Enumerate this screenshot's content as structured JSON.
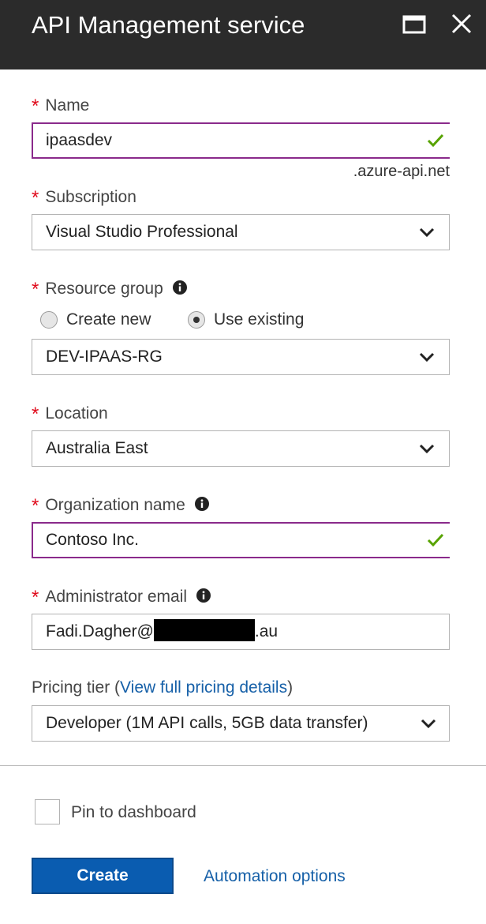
{
  "header": {
    "title": "API Management service"
  },
  "name": {
    "label": "Name",
    "value": "ipaasdev",
    "suffix": ".azure-api.net"
  },
  "subscription": {
    "label": "Subscription",
    "value": "Visual Studio Professional"
  },
  "resource_group": {
    "label": "Resource group",
    "option_new": "Create new",
    "option_existing": "Use existing",
    "selected": "Use existing",
    "value": "DEV-IPAAS-RG"
  },
  "location": {
    "label": "Location",
    "value": "Australia East"
  },
  "organization": {
    "label": "Organization name",
    "value": "Contoso Inc."
  },
  "admin_email": {
    "label": "Administrator email",
    "value_prefix": "Fadi.Dagher@",
    "value_suffix": ".au"
  },
  "pricing": {
    "label_prefix": "Pricing tier (",
    "link": "View full pricing details",
    "label_suffix": ")",
    "value": "Developer (1M API calls, 5GB data transfer)"
  },
  "footer": {
    "pin_label": "Pin to dashboard",
    "pin_checked": false,
    "create_label": "Create",
    "automation_label": "Automation options"
  },
  "required_marker": "*",
  "colors": {
    "header_bg": "#2b2b2b",
    "valid_border": "#8a2a8b",
    "check_green": "#57a300",
    "required_red": "#e00b1c",
    "link_blue": "#1660a8",
    "button_blue": "#0a5cb0"
  },
  "icons": {
    "maximize": "maximize-icon",
    "close": "close-icon",
    "info": "info-icon",
    "check": "checkmark-icon",
    "chevron": "chevron-down-icon"
  }
}
